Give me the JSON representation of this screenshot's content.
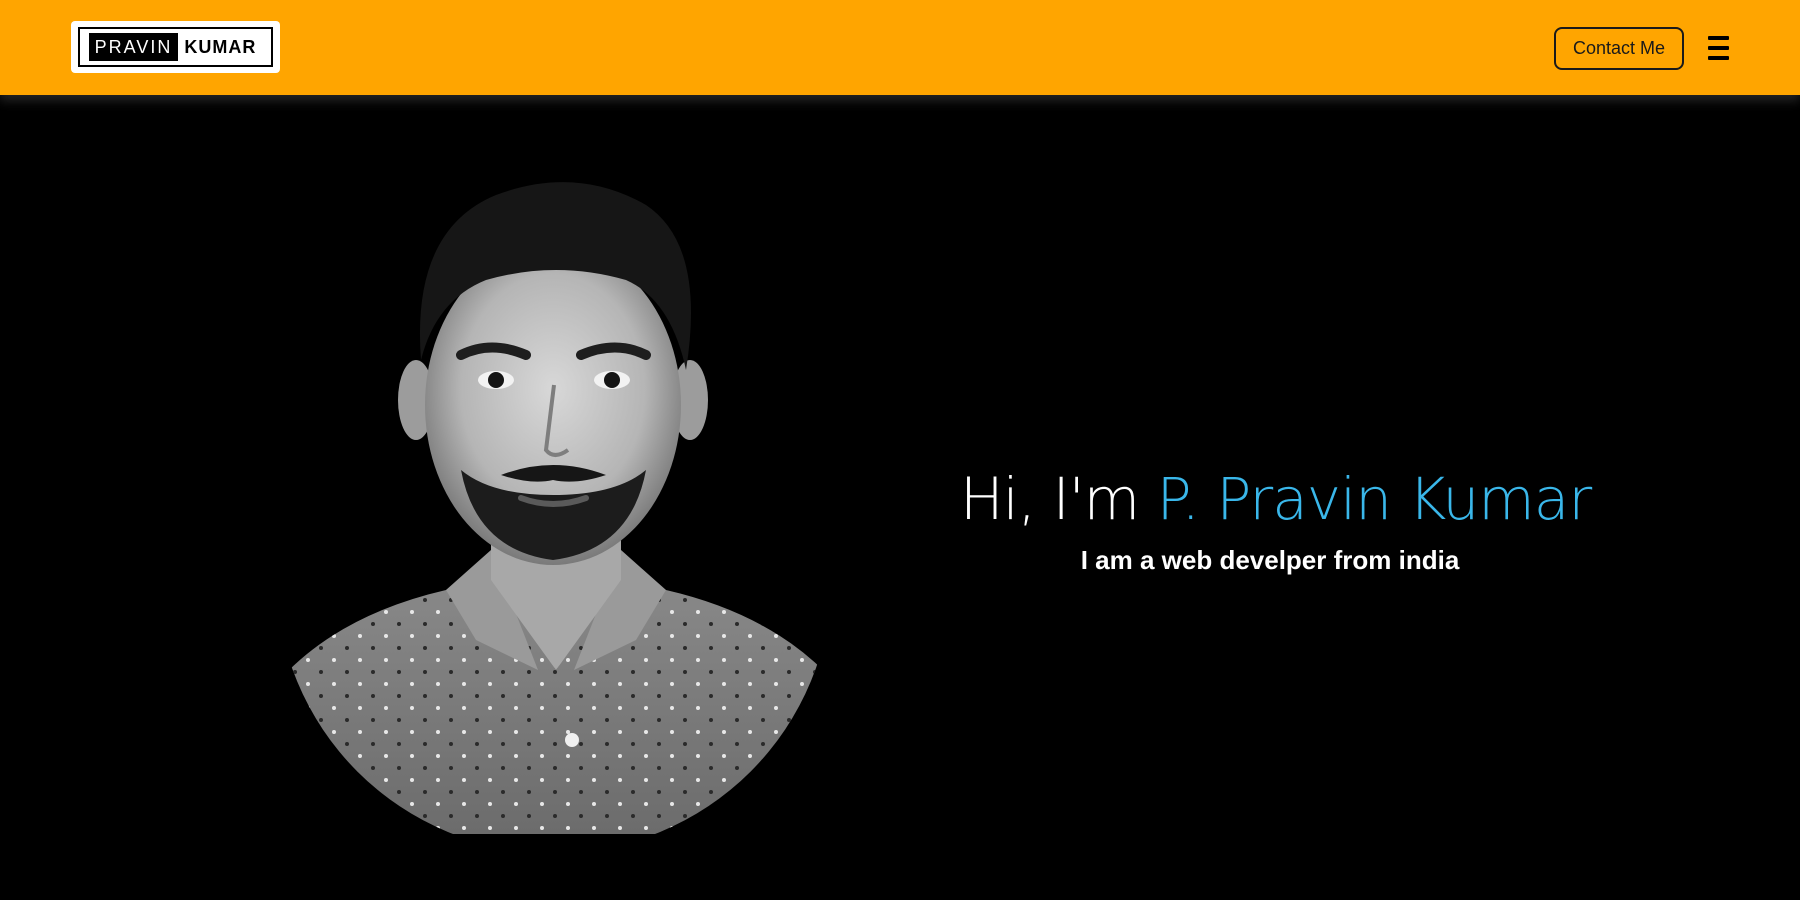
{
  "header": {
    "logo": {
      "part1": "PRAVIN",
      "part2": "KUMAR"
    },
    "contact_label": "Contact Me",
    "menu_icon": "hamburger-menu-icon",
    "background_color": "#ffa500"
  },
  "hero": {
    "greeting_prefix": "Hi, I'm ",
    "name": "P. Pravin Kumar",
    "tagline": "I am a web develper from india",
    "name_color": "#3ab7ea",
    "background_color": "#000000",
    "portrait_icon": "profile-photo"
  }
}
